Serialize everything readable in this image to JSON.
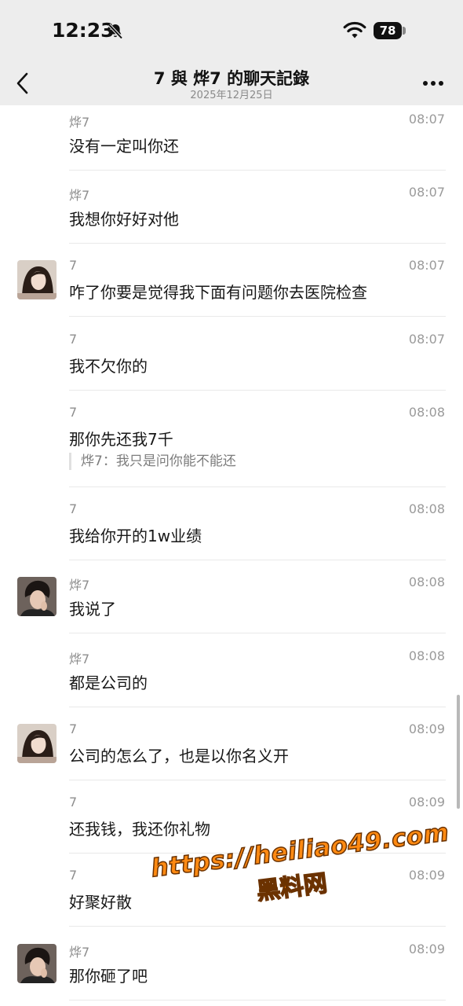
{
  "status_bar": {
    "time": "12:23",
    "battery": "78"
  },
  "header": {
    "title": "7 與 烨7 的聊天記錄",
    "subtitle": "2025年12月25日"
  },
  "messages": [
    {
      "sender": "烨7",
      "time": "08:07",
      "text": "没有一定叫你还",
      "avatar": ""
    },
    {
      "sender": "烨7",
      "time": "08:07",
      "text": "我想你好好对他",
      "avatar": ""
    },
    {
      "sender": "7",
      "time": "08:07",
      "text": "咋了你要是觉得我下面有问题你去医院检查",
      "avatar": "girl"
    },
    {
      "sender": "7",
      "time": "08:07",
      "text": "我不欠你的",
      "avatar": ""
    },
    {
      "sender": "7",
      "time": "08:08",
      "text": "那你先还我7千",
      "avatar": "",
      "quote": "烨7：我只是问你能不能还"
    },
    {
      "sender": "7",
      "time": "08:08",
      "text": "我给你开的1w业绩",
      "avatar": ""
    },
    {
      "sender": "烨7",
      "time": "08:08",
      "text": "我说了",
      "avatar": "boy"
    },
    {
      "sender": "烨7",
      "time": "08:08",
      "text": "都是公司的",
      "avatar": ""
    },
    {
      "sender": "7",
      "time": "08:09",
      "text": "公司的怎么了，也是以你名义开",
      "avatar": "girl"
    },
    {
      "sender": "7",
      "time": "08:09",
      "text": "还我钱，我还你礼物",
      "avatar": ""
    },
    {
      "sender": "7",
      "time": "08:09",
      "text": "好聚好散",
      "avatar": ""
    },
    {
      "sender": "烨7",
      "time": "08:09",
      "text": "那你砸了吧",
      "avatar": "boy"
    }
  ],
  "watermark": {
    "url": "https://heiliao49.com",
    "name": "黑料网"
  },
  "icons": {
    "back": "chevron-left-icon",
    "more": "more-dots-icon",
    "bell": "bell-slash-icon",
    "wifi": "wifi-icon"
  }
}
